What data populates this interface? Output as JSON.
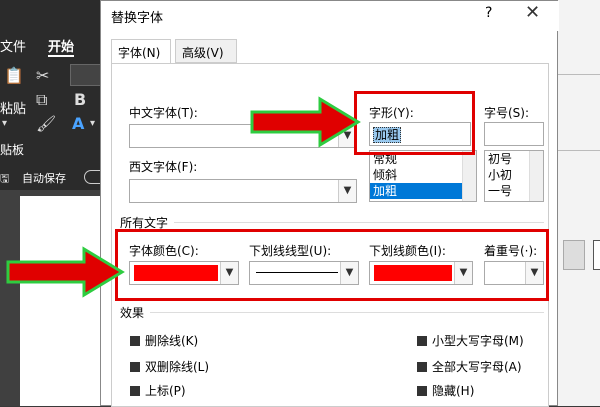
{
  "background": {
    "file_tab": "文件",
    "home_tab": "开始",
    "clipboard_label": "贴板",
    "paste_label": "粘贴",
    "autosave_label": "自动保存"
  },
  "dialog": {
    "title": "替换字体",
    "help": "?",
    "close": "✕",
    "tabs": [
      "字体(N)",
      "高级(V)"
    ],
    "chinese_font_label": "中文字体(T):",
    "western_font_label": "西文字体(F):",
    "style_label": "字形(Y):",
    "style_value": "加粗",
    "style_options": [
      "常规",
      "倾斜",
      "加粗"
    ],
    "size_label": "字号(S):",
    "size_options": [
      "初号",
      "小初",
      "一号"
    ],
    "all_text_label": "所有文字",
    "font_color_label": "字体颜色(C):",
    "underline_type_label": "下划线线型(U):",
    "underline_color_label": "下划线颜色(I):",
    "emphasis_label": "着重号(·):",
    "effects_label": "效果",
    "effects_left": [
      "删除线(K)",
      "双删除线(L)",
      "上标(P)"
    ],
    "effects_right": [
      "小型大写字母(M)",
      "全部大写字母(A)",
      "隐藏(H)"
    ]
  },
  "colors": {
    "highlight": "#e00000",
    "font_color": "#ff0000",
    "arrow_fill": "#e00000",
    "arrow_outline": "#2ecc40"
  }
}
